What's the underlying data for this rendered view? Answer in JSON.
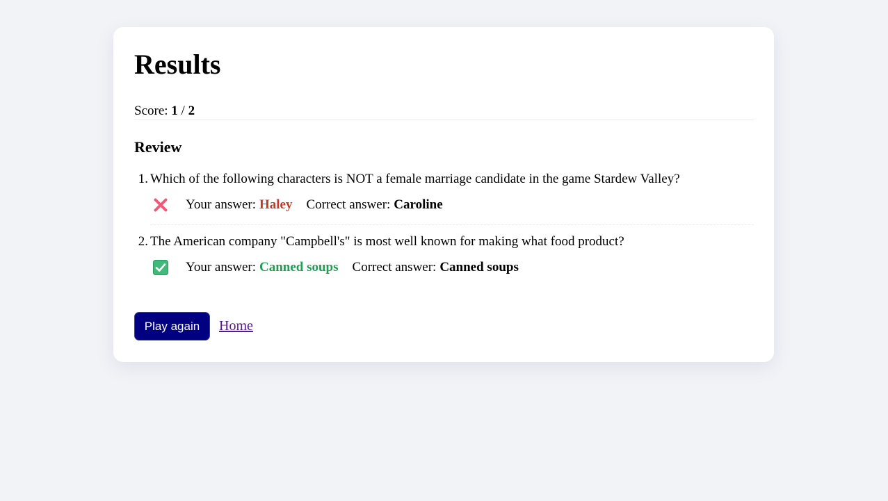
{
  "page": {
    "title": "Results"
  },
  "score": {
    "label": "Score:",
    "correct": "1",
    "separator": "/",
    "total": "2"
  },
  "review": {
    "title": "Review",
    "items": [
      {
        "number": "1.",
        "question": "Which of the following characters is NOT a female marriage candidate in the game Stardew Valley?",
        "status": "incorrect",
        "status_icon": "cross-mark-icon",
        "your_answer_label": "Your answer:",
        "your_answer": "Haley",
        "correct_answer_label": "Correct answer:",
        "correct_answer": "Caroline"
      },
      {
        "number": "2.",
        "question": "The American company \"Campbell's\" is most well known for making what food product?",
        "status": "correct",
        "status_icon": "check-mark-icon",
        "your_answer_label": "Your answer:",
        "your_answer": "Canned soups",
        "correct_answer_label": "Correct answer:",
        "correct_answer": "Canned soups"
      }
    ]
  },
  "actions": {
    "play_again_label": "Play again",
    "home_label": "Home"
  },
  "colors": {
    "background": "#f2f3f7",
    "card": "#ffffff",
    "primary_button": "#000080",
    "wrong_answer": "#c0392b",
    "right_answer": "#1f9d55",
    "cross_icon": "#f05a78",
    "check_icon": "#3fba7a",
    "visited_link": "#551a8b"
  }
}
